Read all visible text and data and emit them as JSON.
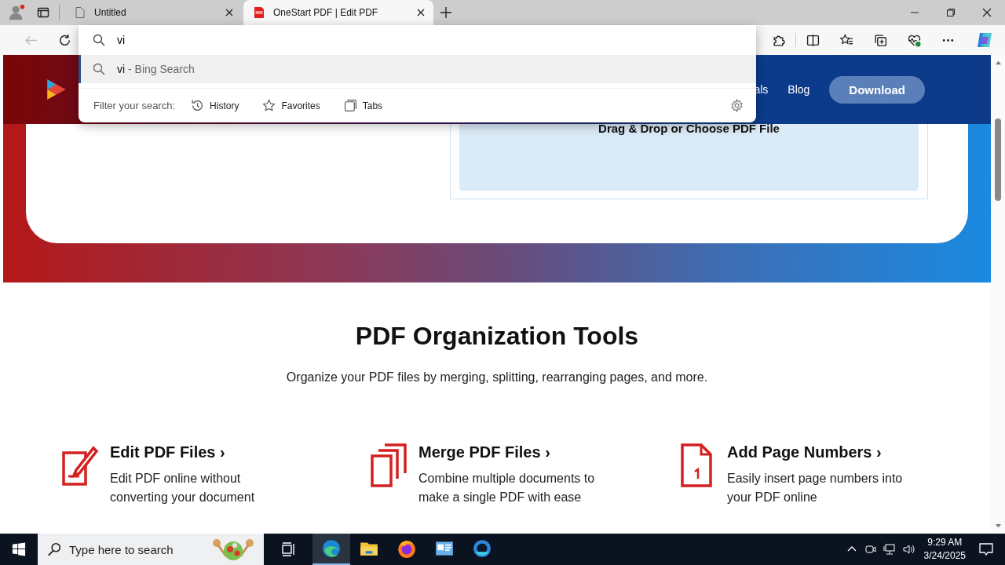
{
  "browser": {
    "tabs": [
      {
        "title": "Untitled",
        "selected": false,
        "kind": "blank"
      },
      {
        "title": "OneStart PDF | Edit PDF",
        "selected": true,
        "kind": "pdf"
      }
    ],
    "address_bar": {
      "value": "vi"
    },
    "suggestions": [
      {
        "query": "vi",
        "suffix": " - Bing Search",
        "selected": true
      }
    ],
    "filter": {
      "label": "Filter your search:",
      "options": [
        {
          "kind": "history",
          "label": "History"
        },
        {
          "kind": "favorites",
          "label": "Favorites"
        },
        {
          "kind": "tabs",
          "label": "Tabs"
        }
      ]
    }
  },
  "site": {
    "nav": [
      "als",
      "Blog"
    ],
    "download_button": "Download",
    "upload_prompt": "Drag & Drop or Choose PDF File",
    "section_title": "PDF Organization Tools",
    "section_subtitle": "Organize your PDF files by merging, splitting, rearranging pages, and more.",
    "tools": [
      {
        "kind": "edit",
        "title": "Edit PDF Files ›",
        "description": "Edit PDF online without converting your document"
      },
      {
        "kind": "merge",
        "title": "Merge PDF Files ›",
        "description": "Combine multiple documents to make a single PDF with ease"
      },
      {
        "kind": "numbers",
        "title": "Add Page Numbers ›",
        "description": "Easily insert page numbers into your PDF online"
      }
    ]
  },
  "taskbar": {
    "search_placeholder": "Type here to search",
    "apps": [
      {
        "kind": "edge",
        "selected": true
      },
      {
        "kind": "explorer",
        "selected": false
      },
      {
        "kind": "firefox",
        "selected": false
      },
      {
        "kind": "control",
        "selected": false
      },
      {
        "kind": "onestart",
        "selected": false
      }
    ],
    "time": "9:29 AM",
    "date": "3/24/2025"
  }
}
